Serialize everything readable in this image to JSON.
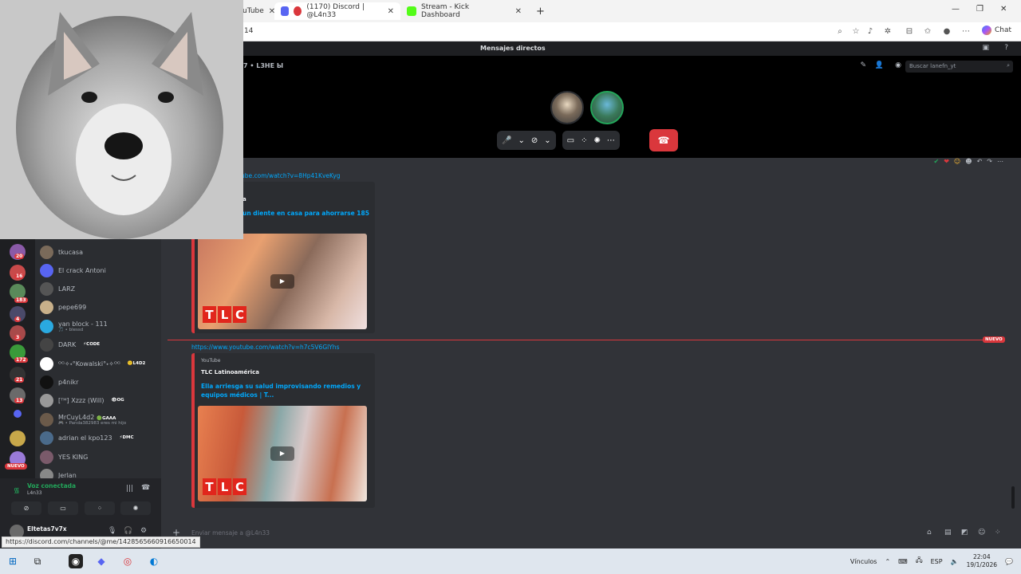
{
  "browser": {
    "tabs": [
      {
        "label": "uTube",
        "close": "✕"
      },
      {
        "label": "(1170) Discord | @L4n33",
        "close": "✕",
        "active": true
      },
      {
        "label": "Stream - Kick Dashboard",
        "close": "✕"
      }
    ],
    "new_tab": "+",
    "url": "14",
    "chat_label": "Chat"
  },
  "discord": {
    "title": "Mensajes directos",
    "call_header": "7 • L3HE Ы",
    "search_placeholder": "Buscar lanefn_yt",
    "dms": [
      {
        "name": "tkucasa",
        "color": "#7a6a5a"
      },
      {
        "name": "El crack Antoni",
        "color": "#5865f2"
      },
      {
        "name": "LARZ",
        "color": "#555555"
      },
      {
        "name": "pepe699",
        "color": "#c8b08a"
      },
      {
        "name": "yan block - 111",
        "sub": "🎵 • blessd",
        "color": "#2aa9e0"
      },
      {
        "name": "DARK",
        "tag": "⚡CODE",
        "color": "#444444"
      },
      {
        "name": "ᴼᴳ✧˖°Kowalski°˖✧ᴼᴳ",
        "tag": "🙂L4D2",
        "color": "#ffffff"
      },
      {
        "name": "p4nikr",
        "color": "#111111"
      },
      {
        "name": "[ᵀᴹ] Xzzz (Will)",
        "tag": "👁OG",
        "color": "#999999"
      },
      {
        "name": "MrCuyL4d2",
        "tag": "🟢GAAA",
        "sub": "🎮 • Panda382983 eres mi hijo",
        "color": "#6b5a4a"
      },
      {
        "name": "adrian el kpo123",
        "tag": "⚡DMC",
        "color": "#4a6a8a"
      },
      {
        "name": "YES KING",
        "color": "#7a5a6a"
      },
      {
        "name": "Jerlan",
        "color": "#888888"
      }
    ],
    "guild_badges": [
      "20",
      "16",
      "183",
      "4",
      "3",
      "172",
      "21",
      "13"
    ],
    "new_label": "NUEVO",
    "voice": {
      "status": "Voz conectada",
      "channel": "L4n33"
    },
    "user": {
      "name": "Eltetas7v7x"
    },
    "messages": [
      {
        "link": "ube.com/watch?v=8Hp41KveKyg",
        "provider": "",
        "author": "a",
        "title": "un diente en casa para ahorrarse 185"
      },
      {
        "link": "https://www.youtube.com/watch?v=h7c5V6GlYhs",
        "provider": "YouTube",
        "author": "TLC Latinoamérica",
        "title": "Ella arriesga su salud improvisando remedios y equipos médicos | T..."
      }
    ],
    "tlc_letters": [
      "T",
      "L",
      "C"
    ],
    "new_marker": "NUEVO",
    "composer_placeholder": "Enviar mensaje a @L4n33"
  },
  "status_url": "https://discord.com/channels/@me/1428565660916650014",
  "taskbar": {
    "links_label": "Vínculos",
    "lang": "ESP",
    "time": "22:04",
    "date": "19/1/2026"
  },
  "colors": {
    "accent_red": "#da373c",
    "link_blue": "#00a8fc",
    "online_green": "#23a55a"
  }
}
